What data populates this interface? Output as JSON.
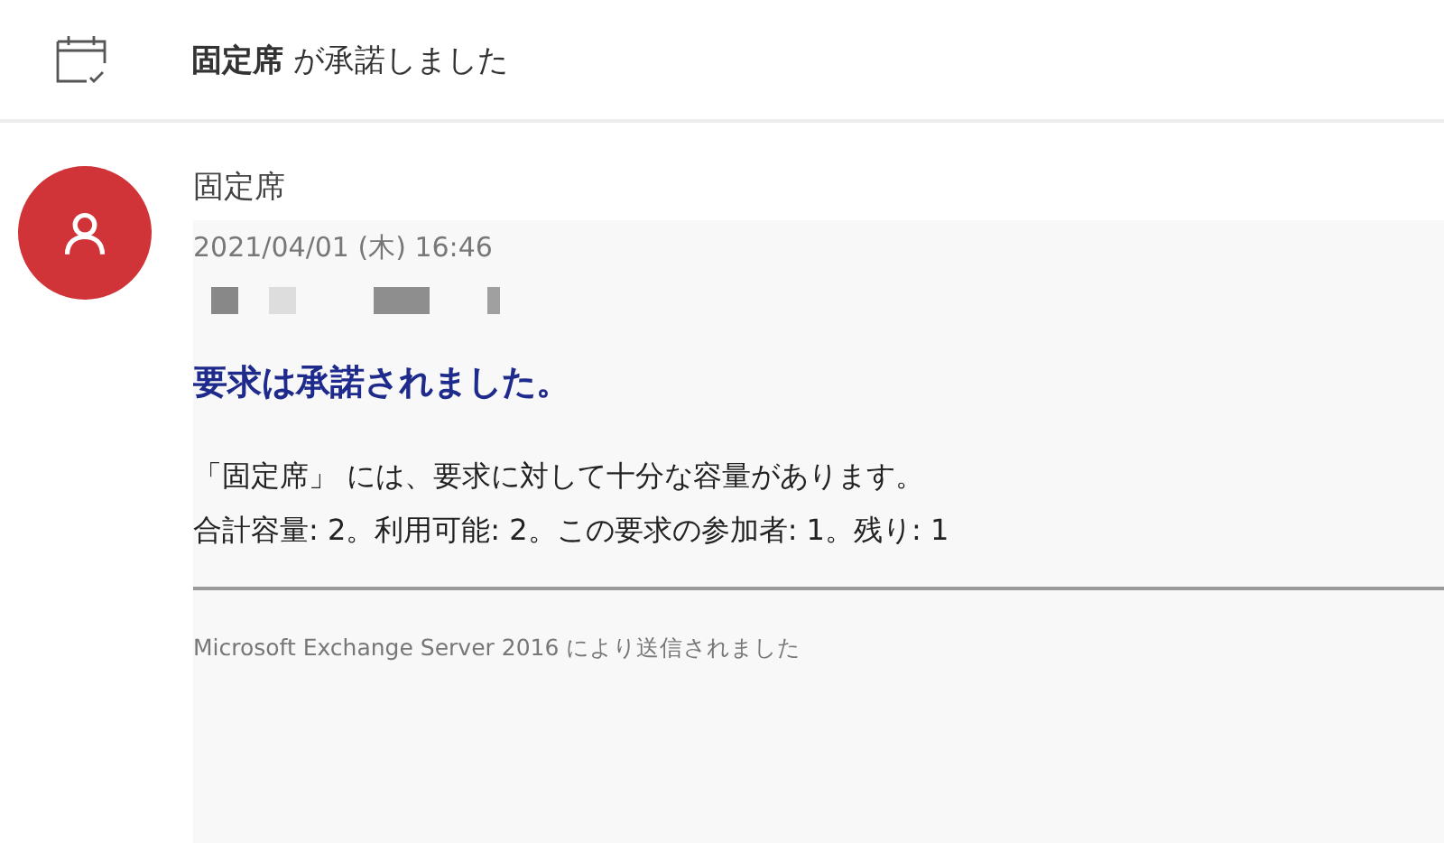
{
  "header": {
    "sender": "固定席",
    "action": "が承諾しました"
  },
  "message": {
    "sender": "固定席",
    "date": "2021/04/01 (木) 16:46",
    "title": "要求は承諾されました。",
    "lines": [
      "「固定席」 には、要求に対して十分な容量があります。",
      "合計容量: 2。利用可能: 2。この要求の参加者: 1。残り: 1"
    ],
    "footer": "Microsoft Exchange Server 2016 により送信されました"
  }
}
